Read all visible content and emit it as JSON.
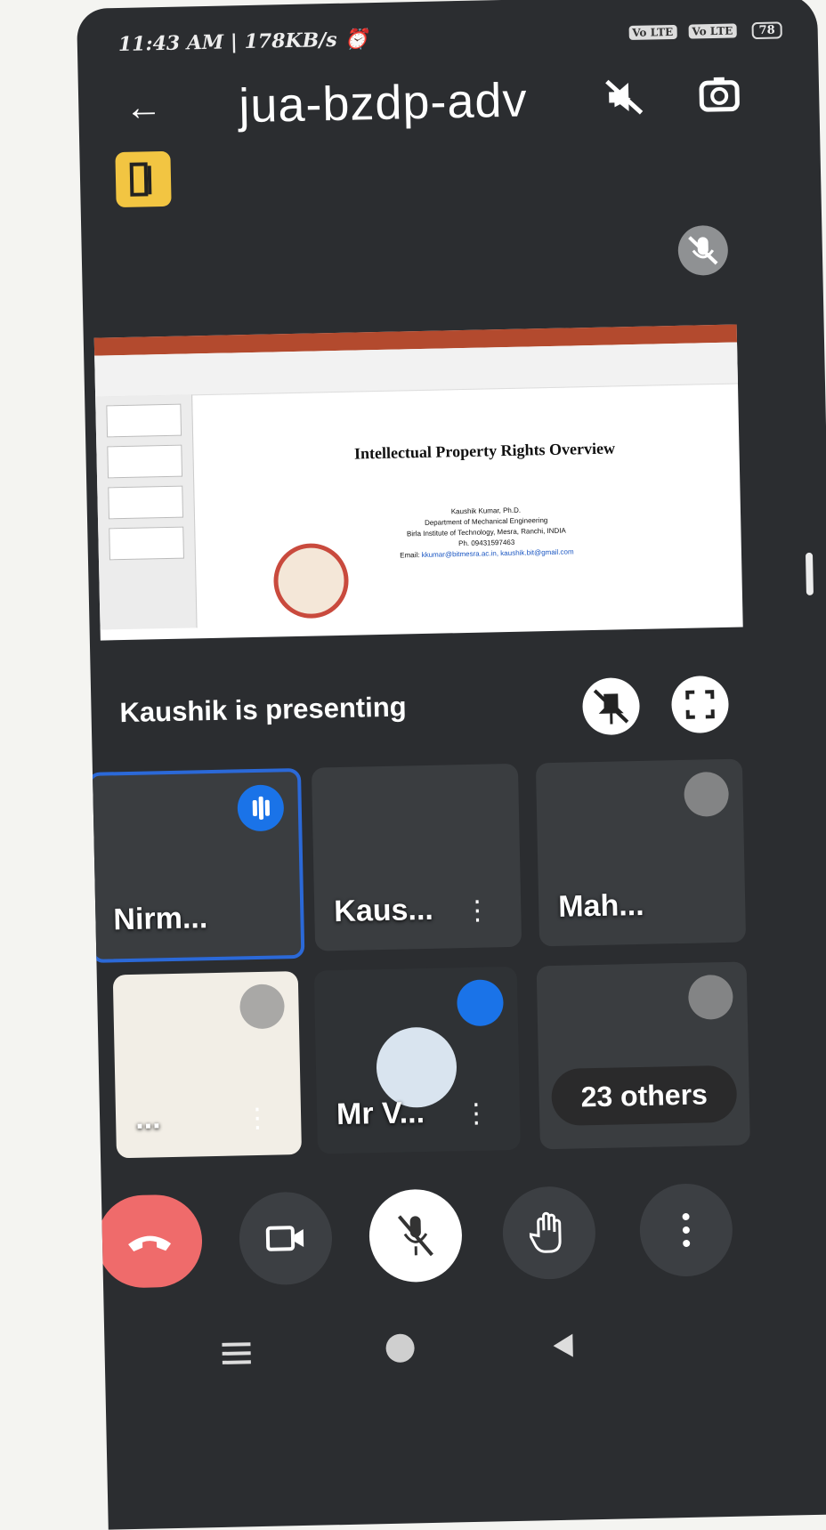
{
  "status_bar": {
    "time_speed": "11:43 AM | 178KB/s",
    "sig1": "Vo LTE",
    "sig2": "Vo LTE",
    "battery": "78"
  },
  "header": {
    "meeting_code": "jua-bzdp-adv"
  },
  "presentation": {
    "slide_title": "Intellectual Property Rights Overview",
    "presenter_name": "Kaushik Kumar, Ph.D.",
    "department": "Department of Mechanical Engineering",
    "institute": "Birla Institute of Technology, Mesra, Ranchi, INDIA",
    "phone": "Ph. 09431597463",
    "email_label": "Email:",
    "email": "kkumar@bitmesra.ac.in, kaushik.bit@gmail.com",
    "status_label": "Kaushik is presenting"
  },
  "participants": [
    {
      "name": "Nirm...",
      "state": "speaking"
    },
    {
      "name": "Kaus...",
      "state": "normal"
    },
    {
      "name": "Mah...",
      "state": "muted"
    },
    {
      "name": "...",
      "state": "muted"
    },
    {
      "name": "Mr V...",
      "state": "speaking"
    },
    {
      "name": "23 others",
      "state": "muted"
    }
  ],
  "controls": {
    "end_call": "phone-icon",
    "camera": "video-camera-icon",
    "microphone": "microphone-off-icon",
    "raise_hand": "hand-icon",
    "more": "more-vertical-icon"
  },
  "colors": {
    "end_call": "#ef6b6b",
    "active_speaker": "#1a73e8",
    "door_button": "#f2c542"
  }
}
